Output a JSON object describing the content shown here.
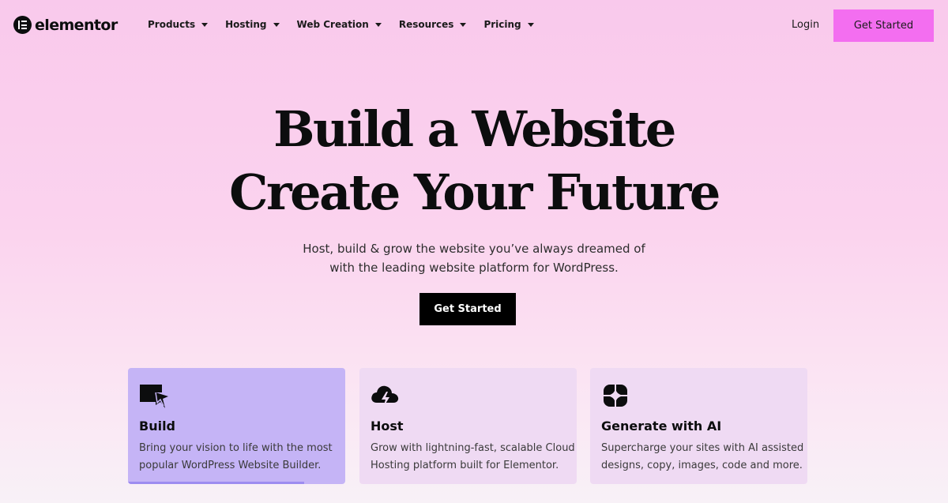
{
  "brand": {
    "name": "elementor",
    "logo_icon": "elementor-logo-icon"
  },
  "nav": {
    "items": [
      {
        "label": "Products"
      },
      {
        "label": "Hosting"
      },
      {
        "label": "Web Creation"
      },
      {
        "label": "Resources"
      },
      {
        "label": "Pricing"
      }
    ],
    "login_label": "Login",
    "cta_label": "Get Started"
  },
  "hero": {
    "title_line1": "Build a Website",
    "title_line2": "Create Your Future",
    "subtitle_line1": "Host, build & grow the website you’ve always dreamed of",
    "subtitle_line2": "with the leading website platform for WordPress.",
    "cta_label": "Get Started"
  },
  "cards": [
    {
      "title": "Build",
      "desc_line1": "Bring your vision to life with the most",
      "desc_line2": "popular WordPress Website Builder.",
      "icon": "cursor-build-icon",
      "active": true,
      "progress": 0.81
    },
    {
      "title": "Host",
      "desc_line1": "Grow with lightning-fast, scalable Cloud",
      "desc_line2": "Hosting platform built for Elementor.",
      "icon": "cloud-lightning-icon",
      "active": false
    },
    {
      "title": "Generate with AI",
      "desc_line1": "Supercharge your sites with AI assisted",
      "desc_line2": "designs, copy, images, code and more.",
      "icon": "ai-sparkle-icon",
      "active": false
    }
  ],
  "colors": {
    "accent_pink": "#f36ef0",
    "active_card": "#c5b4f6",
    "card_bg": "#efdaf3",
    "text_dark": "#0c0d0e"
  }
}
